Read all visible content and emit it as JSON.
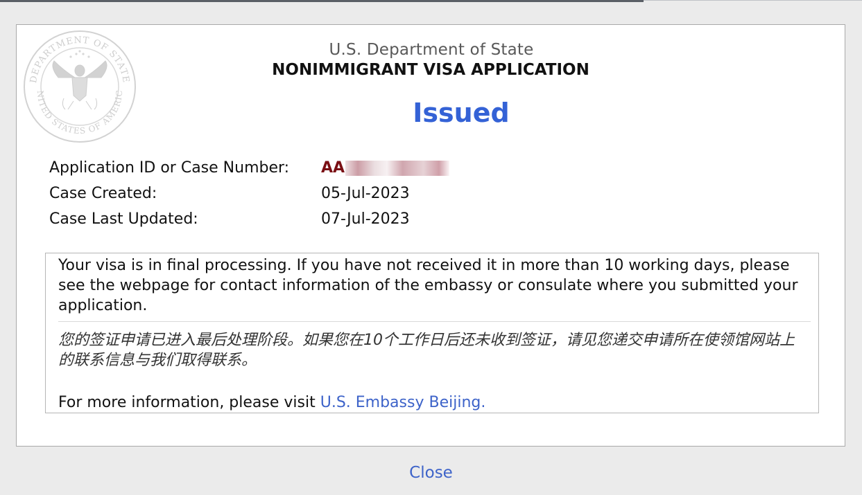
{
  "header": {
    "department": "U.S. Department of State",
    "title": "NONIMMIGRANT VISA APPLICATION",
    "seal_text_top": "DEPARTMENT OF STATE",
    "seal_text_bottom": "UNITED STATES OF AMERICA"
  },
  "status": {
    "label": "Issued",
    "color": "#3462d6"
  },
  "case_info": {
    "application_id_label": "Application ID or Case Number:",
    "application_id_value": "AA",
    "application_id_redacted": true,
    "created_label": "Case Created:",
    "created_value": "05-Jul-2023",
    "updated_label": "Case Last Updated:",
    "updated_value": "07-Jul-2023"
  },
  "message": {
    "english": "Your visa is in final processing. If you have not received it in more than 10 working days, please see the webpage for contact information of the embassy or consulate where you submitted your application.",
    "chinese": "您的签证申请已进入最后处理阶段。如果您在10个工作日后还未收到签证，请见您递交申请所在使领馆网站上的联系信息与我们取得联系。",
    "more_info_prefix": "For more information, please visit ",
    "more_info_link": "U.S. Embassy Beijing."
  },
  "footer": {
    "close_label": "Close"
  },
  "colors": {
    "link": "#3d63c9",
    "case_id": "#7a0f14",
    "status": "#3462d6"
  }
}
